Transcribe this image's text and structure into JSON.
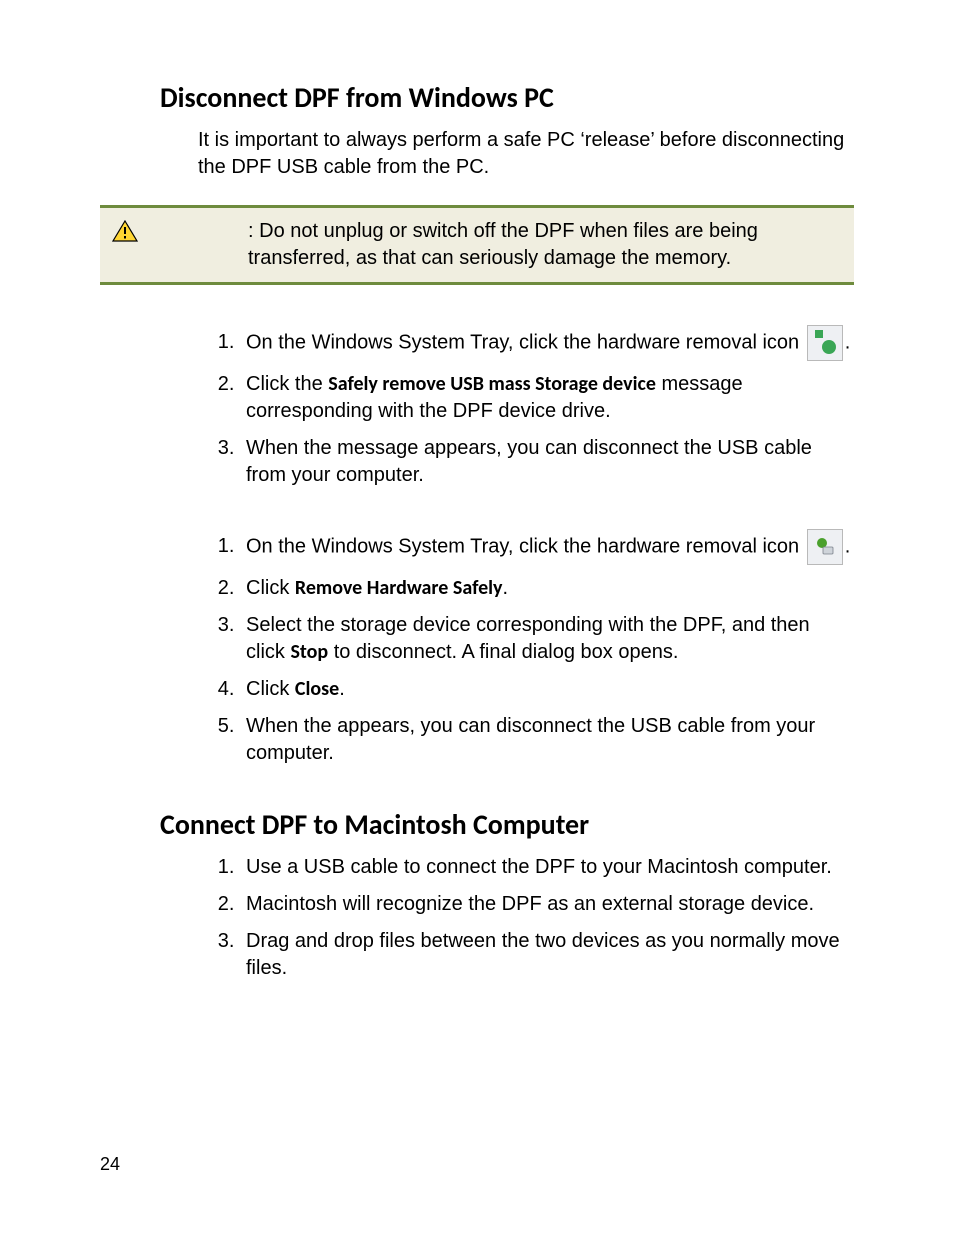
{
  "page_number": "24",
  "sections": {
    "disconnect": {
      "heading": "Disconnect DPF from Windows PC",
      "intro": "It is important to always perform a safe PC ‘release’ before disconnecting the DPF USB cable from the PC.",
      "caution": {
        "colon": ":",
        "text": "Do not unplug or switch off the DPF when files are being transferred, as that can seriously damage the memory."
      },
      "listA": {
        "i1_a": "On the Windows System Tray, click the hardware removal icon ",
        "i1_b": ".",
        "i2_a": "Click the ",
        "i2_bold": "Safely remove USB mass Storage device",
        "i2_b": " message corresponding with the DPF device drive.",
        "i3": "When the message appears, you can disconnect the USB cable from your computer."
      },
      "listB": {
        "i1_a": "On the Windows System Tray, click the hardware removal icon ",
        "i1_b": ".",
        "i2_a": "Click ",
        "i2_bold": "Remove Hardware Safely",
        "i2_b": ".",
        "i3_a": "Select the storage device corresponding with the DPF, and then click ",
        "i3_bold": "Stop",
        "i3_b": " to disconnect. A final dialog box opens.",
        "i4_a": "Click ",
        "i4_bold": "Close",
        "i4_b": ".",
        "i5": "When the appears, you can disconnect the USB cable from your computer."
      }
    },
    "connect_mac": {
      "heading": "Connect DPF to Macintosh Computer",
      "list": {
        "i1": "Use a USB cable to connect the DPF to your Macintosh computer.",
        "i2": "Macintosh will recognize the DPF as an external storage device.",
        "i3": "Drag and drop files between the two devices as you normally move files."
      }
    }
  }
}
